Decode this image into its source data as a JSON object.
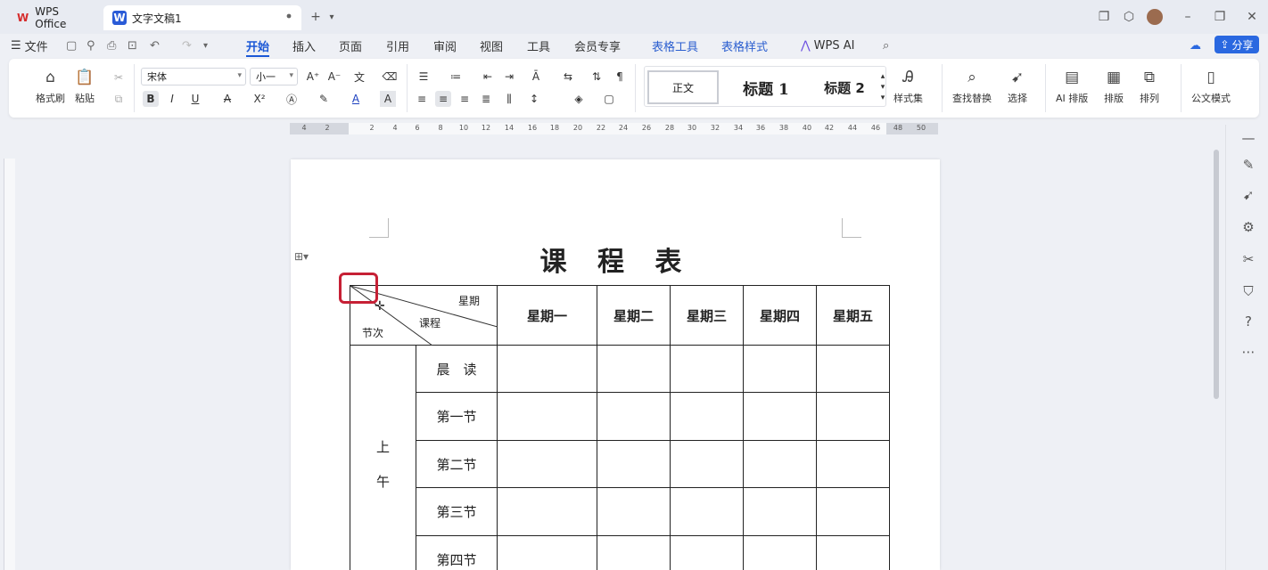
{
  "titlebar": {
    "app_tab": "WPS Office",
    "doc_tab": "文字文稿1"
  },
  "menu": {
    "file": "文件",
    "tabs": [
      "开始",
      "插入",
      "页面",
      "引用",
      "审阅",
      "视图",
      "工具",
      "会员专享"
    ],
    "context_tabs": [
      "表格工具",
      "表格样式"
    ],
    "ai": "WPS AI",
    "share": "分享"
  },
  "ribbon": {
    "format_painter": "格式刷",
    "paste": "粘贴",
    "font_name": "宋体",
    "font_size": "小一",
    "styles": [
      "正文",
      "标题 1",
      "标题 2"
    ],
    "style_set": "样式集",
    "find_replace": "查找替换",
    "select": "选择",
    "ai_layout": "AI 排版",
    "layout": "排版",
    "arrange": "排列",
    "official_mode": "公文模式"
  },
  "ruler": {
    "numbers": [
      "4",
      "2",
      "2",
      "4",
      "6",
      "8",
      "10",
      "12",
      "14",
      "16",
      "18",
      "20",
      "22",
      "24",
      "26",
      "28",
      "30",
      "32",
      "34",
      "36",
      "38",
      "40",
      "42",
      "44",
      "46",
      "48",
      "50"
    ]
  },
  "document": {
    "title": "课 程 表",
    "diag": {
      "top": "星期",
      "mid": "课程",
      "bottom": "节次"
    },
    "days": [
      "星期一",
      "星期二",
      "星期三",
      "星期四",
      "星期五"
    ],
    "period_group": "上\n午",
    "period_group_1": "上",
    "period_group_2": "午",
    "periods": [
      "晨　读",
      "第一节",
      "第二节",
      "第三节",
      "第四节"
    ]
  },
  "colors": {
    "accent": "#1b58d6",
    "highlight": "#c62035"
  }
}
